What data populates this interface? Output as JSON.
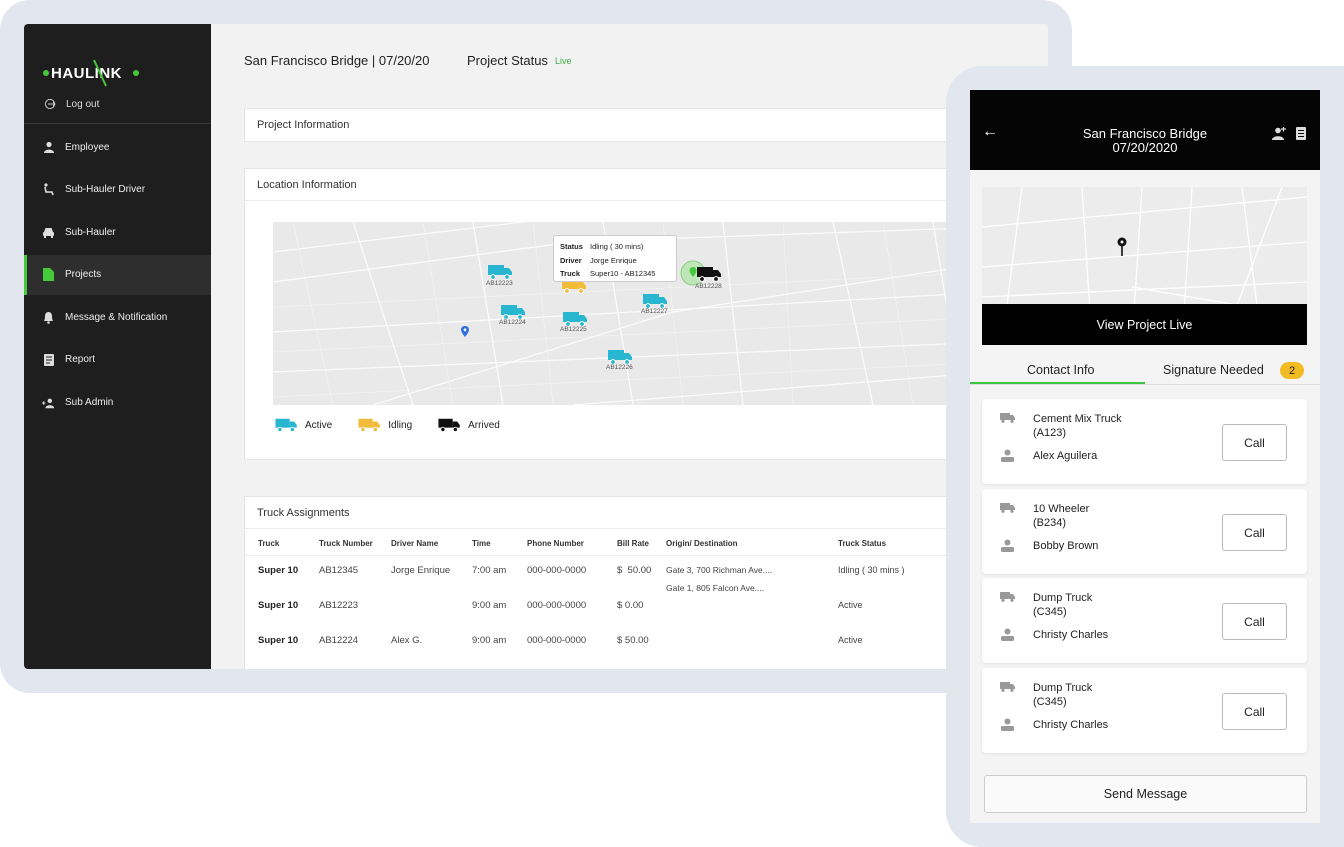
{
  "brand": {
    "logo_text": "HAULINK",
    "accent": "#47c93c",
    "status_live": "#3cb043"
  },
  "sidebar": {
    "logout_label": "Log out",
    "items": [
      {
        "label": "Employee",
        "icon": "person-icon"
      },
      {
        "label": "Sub-Hauler Driver",
        "icon": "seat-icon"
      },
      {
        "label": "Sub-Hauler",
        "icon": "car-icon"
      },
      {
        "label": "Projects",
        "icon": "document-icon",
        "active": true
      },
      {
        "label": "Message & Notification",
        "icon": "bell-icon"
      },
      {
        "label": "Report",
        "icon": "report-icon"
      },
      {
        "label": "Sub Admin",
        "icon": "add-person-icon"
      }
    ]
  },
  "header": {
    "title": "San Francisco Bridge | 07/20/20",
    "status_label": "Project Status",
    "status_value": "Live"
  },
  "project_info": {
    "title": "Project Information"
  },
  "location_info": {
    "title": "Location Information",
    "tooltip": {
      "status_label": "Status",
      "status_value": "Idling ( 30 mins)",
      "driver_label": "Driver",
      "driver_value": "Jorge Enrique",
      "truck_label": "Truck",
      "truck_value": "Super10 - AB12345"
    },
    "trucks": [
      {
        "id": "AB12223",
        "status": "active"
      },
      {
        "id": "AB12224",
        "status": "active"
      },
      {
        "id": "AB12225",
        "status": "active"
      },
      {
        "id": "AB12226",
        "status": "active"
      },
      {
        "id": "AB12227",
        "status": "active"
      },
      {
        "id": "AB12228",
        "status": "arrived"
      }
    ],
    "legend": [
      {
        "label": "Active",
        "color": "#29b6d1"
      },
      {
        "label": "Idling",
        "color": "#f2bb3a"
      },
      {
        "label": "Arrived",
        "color": "#111111"
      }
    ]
  },
  "truck_assignments": {
    "title": "Truck Assignments",
    "columns": [
      "Truck",
      "Truck Number",
      "Driver Name",
      "Time",
      "Phone Number",
      "Bill Rate",
      "Origin/ Destination",
      "Truck Status"
    ],
    "rows": [
      {
        "truck": "Super 10",
        "number": "AB12345",
        "driver": "Jorge Enrique",
        "time": "7:00 am",
        "phone": "000-000-0000",
        "rate": "$  50.00",
        "origin": "Gate 3, 700 Richman Ave....",
        "destination": "Gate 1, 805 Falcon Ave....",
        "status": "Idling ( 30 mins )"
      },
      {
        "truck": "Super 10",
        "number": "AB12223",
        "driver": "",
        "time": "9:00 am",
        "phone": "000-000-0000",
        "rate": "$ 0.00",
        "origin": "",
        "destination": "",
        "status": "Active"
      },
      {
        "truck": "Super 10",
        "number": "AB12224",
        "driver": "Alex G.",
        "time": "9:00 am",
        "phone": "000-000-0000",
        "rate": "$ 50.00",
        "origin": "",
        "destination": "",
        "status": "Active"
      }
    ]
  },
  "mobile": {
    "title_line1": "San Francisco Bridge",
    "title_line2": "07/20/2020",
    "view_live_label": "View Project Live",
    "tabs": [
      {
        "label": "Contact Info",
        "active": true
      },
      {
        "label": "Signature Needed",
        "badge": "2"
      }
    ],
    "contacts": [
      {
        "vehicle": "Cement Mix Truck",
        "code": "(A123)",
        "driver": "Alex Aguilera",
        "call_label": "Call"
      },
      {
        "vehicle": "10 Wheeler",
        "code": "(B234)",
        "driver": "Bobby Brown",
        "call_label": "Call"
      },
      {
        "vehicle": "Dump Truck",
        "code": "(C345)",
        "driver": "Christy Charles",
        "call_label": "Call"
      },
      {
        "vehicle": "Dump Truck",
        "code": "(C345)",
        "driver": "Christy Charles",
        "call_label": "Call"
      }
    ],
    "send_message_label": "Send Message"
  }
}
